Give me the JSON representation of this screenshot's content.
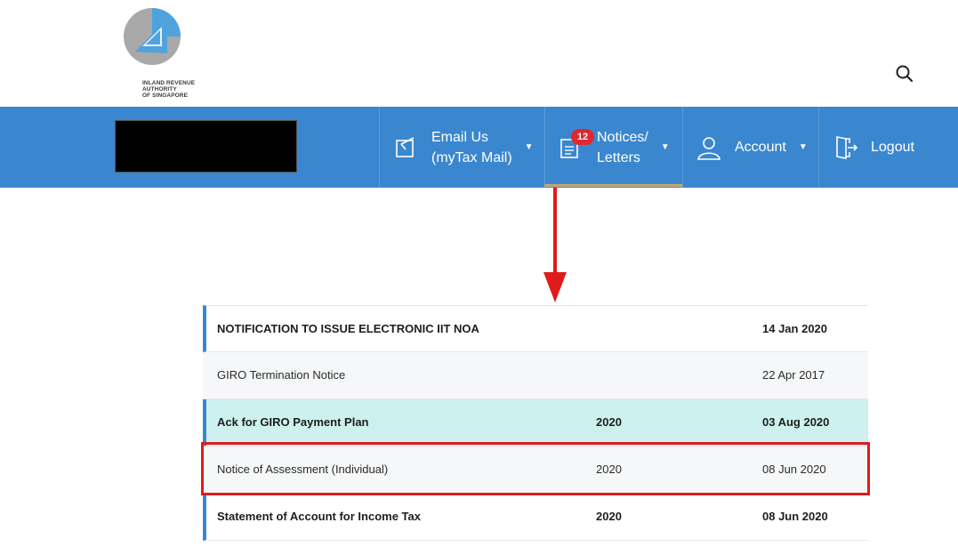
{
  "brand": {
    "logo_lines": [
      "INLAND REVENUE",
      "AUTHORITY",
      "OF SINGAPORE"
    ]
  },
  "header": {
    "search_icon": "search-icon"
  },
  "nav": {
    "email": {
      "line1": "Email Us",
      "line2": "(myTax Mail)",
      "icon": "email-edit-icon"
    },
    "notices": {
      "line1": "Notices/",
      "line2": "Letters",
      "badge": "12",
      "icon": "notice-document-icon"
    },
    "account": {
      "label": "Account",
      "icon": "user-icon"
    },
    "logout": {
      "label": "Logout",
      "icon": "logout-door-icon"
    },
    "caret": "▼"
  },
  "colors": {
    "nav_bg": "#3a87cf",
    "badge": "#e2272e",
    "annotation_red": "#e01b1b",
    "highlight_row": "#cdf1ee"
  },
  "notices": [
    {
      "title": "NOTIFICATION TO ISSUE ELECTRONIC IIT NOA",
      "year": "",
      "date": "14 Jan 2020",
      "unread": true
    },
    {
      "title": "GIRO Termination Notice",
      "year": "",
      "date": "22 Apr 2017",
      "unread": false
    },
    {
      "title": "Ack for GIRO Payment Plan",
      "year": "2020",
      "date": "03 Aug 2020",
      "unread": true
    },
    {
      "title": "Notice of Assessment (Individual)",
      "year": "2020",
      "date": "08 Jun 2020",
      "unread": false
    },
    {
      "title": "Statement of Account for Income Tax",
      "year": "2020",
      "date": "08 Jun 2020",
      "unread": true
    }
  ]
}
